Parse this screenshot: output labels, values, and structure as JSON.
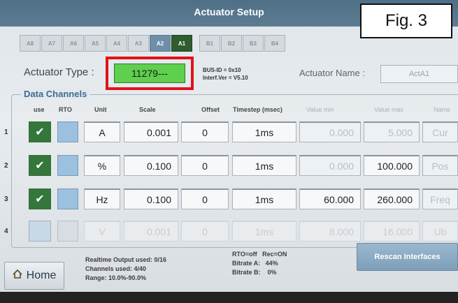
{
  "window": {
    "title": "Actuator Setup"
  },
  "figure_label": {
    "prefix": "Fig. ",
    "number": "3"
  },
  "tabs": [
    "A8",
    "A7",
    "A6",
    "A5",
    "A4",
    "A3",
    "A2",
    "A1",
    "B1",
    "B2",
    "B3",
    "B4"
  ],
  "actuator": {
    "type_label": "Actuator Type :",
    "type_value": "11279---",
    "bus_id": "BUS-ID = 0x10",
    "interface_version": "Interf.Ver = V5.10",
    "name_label": "Actuator Name :",
    "name_value": "ActA1"
  },
  "data_channels": {
    "title": "Data Channels",
    "headers": {
      "use": "use",
      "rto": "RTO",
      "unit": "Unit",
      "scale": "Scale",
      "offset": "Offset",
      "timestep": "Timestep (msec)",
      "value_min": "Value min",
      "value_max": "Value max",
      "name": "Name"
    },
    "rows": [
      {
        "num": "1",
        "use_mark": "✔",
        "unit": "A",
        "scale": "0.001",
        "offset": "0",
        "timestep": "1ms",
        "value_min": "0.000",
        "value_max": "5.000",
        "name": "Cur"
      },
      {
        "num": "2",
        "use_mark": "✔",
        "unit": "%",
        "scale": "0.100",
        "offset": "0",
        "timestep": "1ms",
        "value_min": "0.000",
        "value_max": "100.000",
        "name": "Pos"
      },
      {
        "num": "3",
        "use_mark": "✔",
        "unit": "Hz",
        "scale": "0.100",
        "offset": "0",
        "timestep": "1ms",
        "value_min": "60.000",
        "value_max": "260.000",
        "name": "Freq"
      },
      {
        "num": "4",
        "use_mark": "",
        "unit": "V",
        "scale": "0.001",
        "offset": "0",
        "timestep": "1ms",
        "value_min": "8.000",
        "value_max": "16.000",
        "name": "Ub"
      }
    ]
  },
  "status": {
    "realtime": "Realtime Output used: 0/16",
    "channels": "Channels used: 4/40",
    "range": "Range: 10.0%-90.0%",
    "rto_rec": "RTO=off   Rec=ON",
    "bitrate_a": "Bitrate A:   44%",
    "bitrate_b": "Bitrate B:    0%"
  },
  "buttons": {
    "home": "Home",
    "rescan": "Rescan Interfaces"
  },
  "icons": {
    "home": "home-icon",
    "check": "checkmark-icon"
  },
  "colors": {
    "title_bar": "#5d7d93",
    "active_tab_a1": "#2f5d2f",
    "selected_tab_a2": "#6e8fa7",
    "type_box": "#5fcf4e",
    "highlight_frame": "#e0131a",
    "check_on": "#33773a",
    "rto_on": "#9cc0df"
  }
}
